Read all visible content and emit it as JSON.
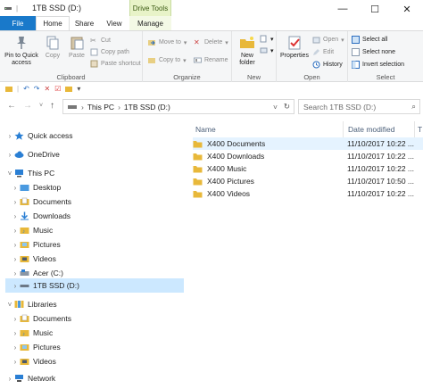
{
  "window": {
    "title": "1TB SSD (D:)",
    "contextual_tab_header": "Drive Tools",
    "controls": {
      "minimize": "—",
      "maximize": "☐",
      "close": "✕"
    }
  },
  "ribbon_tabs": {
    "file": "File",
    "home": "Home",
    "share": "Share",
    "view": "View",
    "manage": "Manage"
  },
  "ribbon": {
    "clipboard": {
      "label": "Clipboard",
      "pin": "Pin to Quick access",
      "copy": "Copy",
      "paste": "Paste",
      "cut": "Cut",
      "copy_path": "Copy path",
      "paste_shortcut": "Paste shortcut"
    },
    "organize": {
      "label": "Organize",
      "move_to": "Move to",
      "copy_to": "Copy to",
      "delete": "Delete",
      "rename": "Rename"
    },
    "new": {
      "label": "New",
      "new_folder": "New folder"
    },
    "open": {
      "label": "Open",
      "properties": "Properties",
      "open": "Open",
      "edit": "Edit",
      "history": "History"
    },
    "select": {
      "label": "Select",
      "select_all": "Select all",
      "select_none": "Select none",
      "invert": "Invert selection"
    }
  },
  "address": {
    "crumbs": [
      "This PC",
      "1TB SSD (D:)"
    ],
    "search_placeholder": "Search 1TB SSD (D:)"
  },
  "nav": [
    {
      "label": "Quick access",
      "icon": "star-icon"
    },
    {
      "label": "OneDrive",
      "icon": "cloud-icon"
    },
    {
      "label": "This PC",
      "icon": "computer-icon"
    },
    {
      "label": "Desktop",
      "icon": "folder-blue-icon"
    },
    {
      "label": "Documents",
      "icon": "documents-icon"
    },
    {
      "label": "Downloads",
      "icon": "downloads-icon"
    },
    {
      "label": "Music",
      "icon": "music-icon"
    },
    {
      "label": "Pictures",
      "icon": "pictures-icon"
    },
    {
      "label": "Videos",
      "icon": "videos-icon"
    },
    {
      "label": "Acer (C:)",
      "icon": "drive-c-icon"
    },
    {
      "label": "1TB SSD (D:)",
      "icon": "drive-d-icon"
    },
    {
      "label": "Libraries",
      "icon": "libraries-icon"
    },
    {
      "label": "Documents",
      "icon": "documents-icon"
    },
    {
      "label": "Music",
      "icon": "music-icon"
    },
    {
      "label": "Pictures",
      "icon": "pictures-icon"
    },
    {
      "label": "Videos",
      "icon": "videos-icon"
    },
    {
      "label": "Network",
      "icon": "network-icon"
    }
  ],
  "columns": {
    "name": "Name",
    "date": "Date modified",
    "type_cut": "T"
  },
  "files": [
    {
      "name": "X400 Documents",
      "date": "11/10/2017 10:22 ..."
    },
    {
      "name": "X400 Downloads",
      "date": "11/10/2017 10:22 ..."
    },
    {
      "name": "X400 Music",
      "date": "11/10/2017 10:22 ..."
    },
    {
      "name": "X400 Pictures",
      "date": "11/10/2017 10:50 ..."
    },
    {
      "name": "X400 Videos",
      "date": "11/10/2017 10:22 ..."
    }
  ],
  "colors": {
    "file_tab": "#1979ca",
    "selected": "#cce8ff",
    "folder": "#e8b83a",
    "context_tab": "#e8f3c8"
  }
}
